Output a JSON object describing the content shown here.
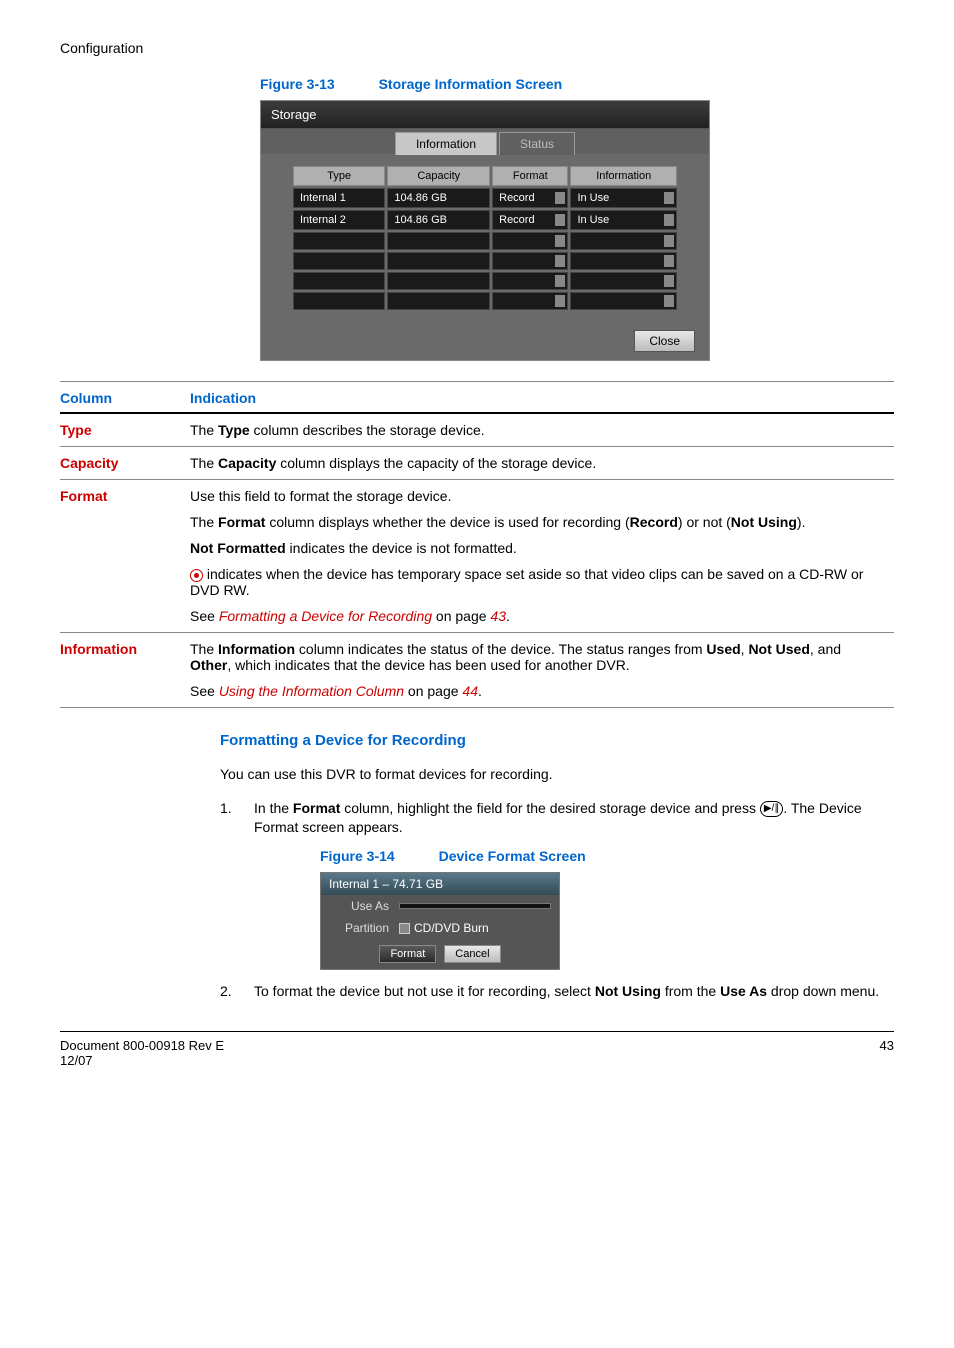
{
  "section_header": "Configuration",
  "figure1": {
    "label": "Figure 3-13",
    "title": "Storage Information Screen"
  },
  "storage_screen": {
    "title": "Storage",
    "tabs": {
      "info": "Information",
      "status": "Status"
    },
    "headers": {
      "type": "Type",
      "capacity": "Capacity",
      "format": "Format",
      "information": "Information"
    },
    "rows": [
      {
        "type": "Internal 1",
        "capacity": "104.86 GB",
        "format": "Record",
        "information": "In Use"
      },
      {
        "type": "Internal 2",
        "capacity": "104.86 GB",
        "format": "Record",
        "information": "In Use"
      }
    ],
    "close": "Close"
  },
  "columns_header": {
    "col": "Column",
    "ind": "Indication"
  },
  "defs": {
    "type": {
      "label": "Type",
      "pre": "The ",
      "bold": "Type",
      "post": " column describes the storage device."
    },
    "capacity": {
      "label": "Capacity",
      "pre": "The ",
      "bold": "Capacity",
      "post": " column displays the capacity of the storage device."
    },
    "format": {
      "label": "Format",
      "p1": "Use this field to format the storage device.",
      "p2_pre": "The ",
      "p2_b1": "Format",
      "p2_mid": " column displays whether the device is used for recording (",
      "p2_b2": "Record",
      "p2_mid2": ") or not (",
      "p2_b3": "Not Using",
      "p2_end": ").",
      "p3_b": "Not Formatted",
      "p3_rest": " indicates the device is not formatted.",
      "p4": " indicates when the device has temporary space set aside so that video clips can be saved on a CD-RW or DVD RW.",
      "p5_pre": "See ",
      "p5_link": "Formatting a Device for Recording",
      "p5_mid": " on page ",
      "p5_page": "43",
      "p5_end": "."
    },
    "info": {
      "label": "Information",
      "p1_pre": "The ",
      "p1_b1": "Information",
      "p1_mid": " column indicates the status of the device. The status ranges from ",
      "p1_b2": "Used",
      "p1_c1": ", ",
      "p1_b3": "Not Used",
      "p1_c2": ", and ",
      "p1_b4": "Other",
      "p1_end": ", which indicates that the device has been used for another DVR.",
      "p2_pre": "See ",
      "p2_link": "Using the Information Column",
      "p2_mid": " on page ",
      "p2_page": "44",
      "p2_end": "."
    }
  },
  "subhead": "Formatting a Device for Recording",
  "para1": "You can use this DVR to format devices for recording.",
  "step1": {
    "num": "1.",
    "pre": "In the ",
    "b1": "Format",
    "mid": " column, highlight the field for the desired storage device and press ",
    "post": ". The Device Format screen appears."
  },
  "figure2": {
    "label": "Figure 3-14",
    "title": "Device Format Screen"
  },
  "device_format": {
    "header": "Internal 1 – 74.71 GB",
    "use_as_label": "Use As",
    "use_as_value": "",
    "partition_label": "Partition",
    "partition_value": "CD/DVD Burn",
    "format_btn": "Format",
    "cancel_btn": "Cancel"
  },
  "step2": {
    "num": "2.",
    "pre": "To format the device but not use it for recording, select ",
    "b1": "Not Using",
    "mid": " from the ",
    "b2": "Use As",
    "post": " drop down menu."
  },
  "footer": {
    "left1": "Document 800-00918 Rev E",
    "left2": "12/07",
    "right": "43"
  }
}
